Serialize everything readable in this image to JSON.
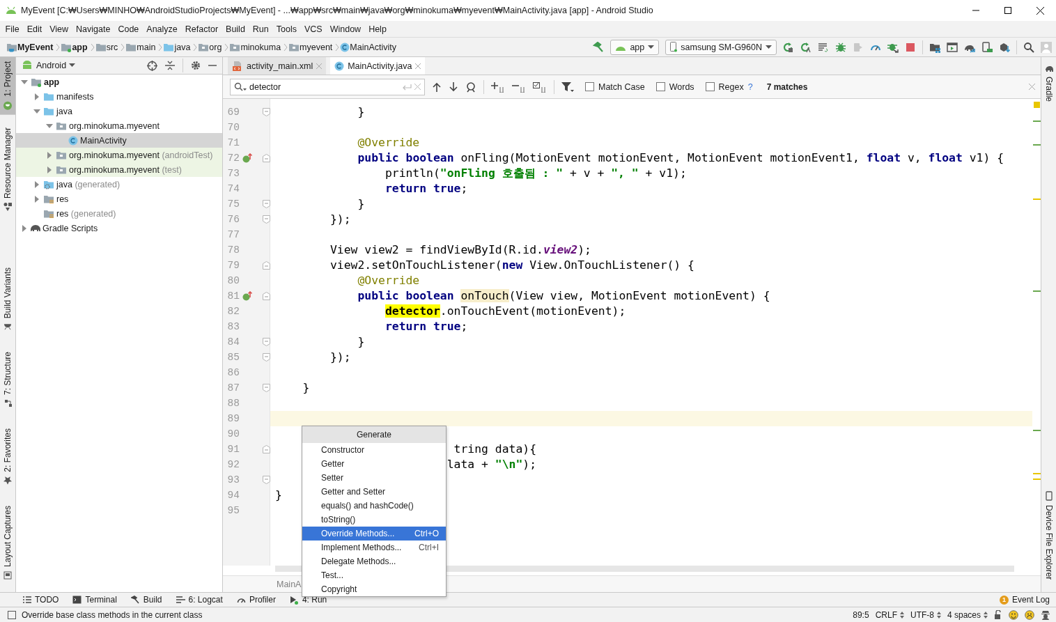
{
  "window": {
    "title": "MyEvent [C:₩Users₩MINHO₩AndroidStudioProjects₩MyEvent] - ...₩app₩src₩main₩java₩org₩minokuma₩myevent₩MainActivity.java [app] - Android Studio"
  },
  "menu": [
    "File",
    "Edit",
    "View",
    "Navigate",
    "Code",
    "Analyze",
    "Refactor",
    "Build",
    "Run",
    "Tools",
    "VCS",
    "Window",
    "Help"
  ],
  "breadcrumbs": [
    {
      "label": "MyEvent",
      "kind": "project"
    },
    {
      "label": "app",
      "kind": "module"
    },
    {
      "label": "src",
      "kind": "folder"
    },
    {
      "label": "main",
      "kind": "folder"
    },
    {
      "label": "java",
      "kind": "source-folder"
    },
    {
      "label": "org",
      "kind": "package"
    },
    {
      "label": "minokuma",
      "kind": "package"
    },
    {
      "label": "myevent",
      "kind": "package"
    },
    {
      "label": "MainActivity",
      "kind": "class"
    }
  ],
  "toolbar": {
    "configuration": "app",
    "device": "samsung SM-G960N"
  },
  "left_tools_top": [
    {
      "label": "1: Project",
      "kind": "project",
      "selected": true
    },
    {
      "label": "Resource Manager",
      "kind": "resources",
      "selected": false
    }
  ],
  "left_tools_bottom": [
    {
      "label": "Build Variants",
      "kind": "variants",
      "selected": false
    },
    {
      "label": "7: Structure",
      "kind": "structure",
      "selected": false
    },
    {
      "label": "2: Favorites",
      "kind": "favorites",
      "selected": false
    },
    {
      "label": "Layout Captures",
      "kind": "captures",
      "selected": false
    }
  ],
  "right_tools_top": [
    {
      "label": "Gradle",
      "kind": "gradle",
      "selected": false
    }
  ],
  "right_tools_bottom": [
    {
      "label": "Device File Explorer",
      "kind": "device",
      "selected": false
    }
  ],
  "project_panel": {
    "view": "Android",
    "tree": [
      {
        "label": "app",
        "kind": "module",
        "expanded": true,
        "selected": false,
        "test": false,
        "children": [
          {
            "label": "manifests",
            "kind": "source-folder",
            "expanded": false,
            "selected": false,
            "test": false
          },
          {
            "label": "java",
            "kind": "source-folder",
            "expanded": true,
            "selected": false,
            "test": false,
            "children": [
              {
                "label": "org.minokuma.myevent",
                "kind": "package",
                "expanded": true,
                "selected": false,
                "test": false,
                "children": [
                  {
                    "label": "MainActivity",
                    "kind": "class",
                    "selected": true,
                    "test": false
                  }
                ]
              },
              {
                "label": "org.minokuma.myevent",
                "suffix": "(androidTest)",
                "kind": "package",
                "expanded": false,
                "selected": false,
                "test": true
              },
              {
                "label": "org.minokuma.myevent",
                "suffix": "(test)",
                "kind": "package",
                "expanded": false,
                "selected": false,
                "test": true
              }
            ]
          },
          {
            "label": "java",
            "suffix": "(generated)",
            "kind": "generated-folder",
            "expanded": false,
            "selected": false,
            "test": false
          },
          {
            "label": "res",
            "kind": "res-folder",
            "expanded": false,
            "selected": false,
            "test": false
          },
          {
            "label": "res",
            "suffix": "(generated)",
            "kind": "res-folder",
            "selected": false,
            "test": false
          }
        ]
      },
      {
        "label": "Gradle Scripts",
        "kind": "gradle",
        "expanded": false,
        "selected": false,
        "test": false
      }
    ]
  },
  "editor_tabs": [
    {
      "label": "activity_main.xml",
      "kind": "xml",
      "selected": false
    },
    {
      "label": "MainActivity.java",
      "kind": "class",
      "selected": true
    }
  ],
  "find_bar": {
    "query": "detector",
    "options": [
      {
        "label": "Match Case",
        "checked": false
      },
      {
        "label": "Words",
        "checked": false
      },
      {
        "label": "Regex",
        "checked": false
      }
    ],
    "help": "?",
    "matches": "7 matches"
  },
  "code_lines": [
    {
      "n": "69",
      "fold_end": true,
      "override": false,
      "current": false,
      "tokens": [
        {
          "kind": "plain",
          "text": "            }"
        }
      ]
    },
    {
      "n": "70",
      "override": false,
      "current": false
    },
    {
      "n": "71",
      "override": false,
      "current": false,
      "tokens": [
        {
          "kind": "annotation",
          "text": "            @Override"
        }
      ]
    },
    {
      "n": "72",
      "fold_start": true,
      "override": true,
      "current": false,
      "tokens": [
        {
          "kind": "keyword",
          "text": "            public"
        },
        {
          "kind": "keyword",
          "text": " boolean"
        },
        {
          "kind": "plain",
          "text": " onFling(MotionEvent motionEvent, MotionEvent motionEvent1, "
        },
        {
          "kind": "keyword",
          "text": "float"
        },
        {
          "kind": "plain",
          "text": " v, "
        },
        {
          "kind": "keyword",
          "text": "float"
        },
        {
          "kind": "plain",
          "text": " v1) {"
        }
      ]
    },
    {
      "n": "73",
      "override": false,
      "current": false,
      "tokens": [
        {
          "kind": "plain",
          "text": "                println("
        },
        {
          "kind": "string",
          "text": "\"onFling 호출됨 : \""
        },
        {
          "kind": "plain",
          "text": " + v + "
        },
        {
          "kind": "string",
          "text": "\", \""
        },
        {
          "kind": "plain",
          "text": " + v1);"
        }
      ]
    },
    {
      "n": "74",
      "override": false,
      "current": false,
      "tokens": [
        {
          "kind": "keyword",
          "text": "                return"
        },
        {
          "kind": "keyword",
          "text": " true"
        },
        {
          "kind": "plain",
          "text": ";"
        }
      ]
    },
    {
      "n": "75",
      "fold_end": true,
      "override": false,
      "current": false,
      "tokens": [
        {
          "kind": "plain",
          "text": "            }"
        }
      ]
    },
    {
      "n": "76",
      "fold_end": true,
      "override": false,
      "current": false,
      "tokens": [
        {
          "kind": "plain",
          "text": "        });"
        }
      ]
    },
    {
      "n": "77",
      "override": false,
      "current": false
    },
    {
      "n": "78",
      "override": false,
      "current": false,
      "tokens": [
        {
          "kind": "plain",
          "text": "        View view2 = findViewById(R.id."
        },
        {
          "kind": "field",
          "text": "view2"
        },
        {
          "kind": "plain",
          "text": ");"
        }
      ]
    },
    {
      "n": "79",
      "fold_start": true,
      "override": false,
      "current": false,
      "tokens": [
        {
          "kind": "plain",
          "text": "        view2.setOnTouchListener("
        },
        {
          "kind": "keyword",
          "text": "new"
        },
        {
          "kind": "plain",
          "text": " View.OnTouchListener() {"
        }
      ]
    },
    {
      "n": "80",
      "override": false,
      "current": false,
      "tokens": [
        {
          "kind": "annotation",
          "text": "            @Override"
        }
      ]
    },
    {
      "n": "81",
      "fold_start": true,
      "override": true,
      "current": false,
      "tokens": [
        {
          "kind": "keyword",
          "text": "            public"
        },
        {
          "kind": "keyword",
          "text": " boolean"
        },
        {
          "kind": "usage",
          "text": " onTouch"
        },
        {
          "kind": "plain",
          "text": "(View view, MotionEvent motionEvent) {"
        }
      ]
    },
    {
      "n": "82",
      "override": false,
      "current": false,
      "tokens": [
        {
          "kind": "match",
          "text": "                detector"
        },
        {
          "kind": "plain",
          "text": ".onTouchEvent(motionEvent);"
        }
      ]
    },
    {
      "n": "83",
      "override": false,
      "current": false,
      "tokens": [
        {
          "kind": "keyword",
          "text": "                return"
        },
        {
          "kind": "keyword",
          "text": " true"
        },
        {
          "kind": "plain",
          "text": ";"
        }
      ]
    },
    {
      "n": "84",
      "fold_end": true,
      "override": false,
      "current": false,
      "tokens": [
        {
          "kind": "plain",
          "text": "            }"
        }
      ]
    },
    {
      "n": "85",
      "fold_end": true,
      "override": false,
      "current": false,
      "tokens": [
        {
          "kind": "plain",
          "text": "        });"
        }
      ]
    },
    {
      "n": "86",
      "override": false,
      "current": false
    },
    {
      "n": "87",
      "fold_end": true,
      "override": false,
      "current": false,
      "tokens": [
        {
          "kind": "plain",
          "text": "    }"
        }
      ]
    },
    {
      "n": "88",
      "override": false,
      "current": false
    },
    {
      "n": "89",
      "override": false,
      "current": true
    },
    {
      "n": "90",
      "override": false,
      "current": false
    },
    {
      "n": "91",
      "fold_start": true,
      "override": false,
      "current": false,
      "tokens": [
        {
          "kind": "plain",
          "text": "                          tring data){"
        }
      ]
    },
    {
      "n": "92",
      "override": false,
      "current": false,
      "tokens": [
        {
          "kind": "plain",
          "text": "                         lata + "
        },
        {
          "kind": "string",
          "text": "\"\\n\""
        },
        {
          "kind": "plain",
          "text": ");"
        }
      ]
    },
    {
      "n": "93",
      "fold_end": true,
      "override": false,
      "current": false
    },
    {
      "n": "94",
      "override": false,
      "current": false,
      "tokens": [
        {
          "kind": "plain",
          "text": "}"
        }
      ]
    },
    {
      "n": "95",
      "override": false,
      "current": false
    }
  ],
  "editor_breadcrumb": "MainA",
  "generate_popup": {
    "title": "Generate",
    "items": [
      {
        "label": "Constructor",
        "selected": false
      },
      {
        "label": "Getter",
        "selected": false
      },
      {
        "label": "Setter",
        "selected": false
      },
      {
        "label": "Getter and Setter",
        "selected": false
      },
      {
        "label": "equals() and hashCode()",
        "selected": false
      },
      {
        "label": "toString()",
        "selected": false
      },
      {
        "label": "Override Methods...",
        "shortcut": "Ctrl+O",
        "selected": true
      },
      {
        "label": "Implement Methods...",
        "shortcut": "Ctrl+I",
        "selected": false
      },
      {
        "label": "Delegate Methods...",
        "selected": false
      },
      {
        "label": "Test...",
        "selected": false
      },
      {
        "label": "Copyright",
        "selected": false
      }
    ]
  },
  "bottom_tools": [
    {
      "label": "TODO",
      "kind": "todo"
    },
    {
      "label": "Terminal",
      "kind": "terminal"
    },
    {
      "label": "Build",
      "kind": "build"
    },
    {
      "label": "6: Logcat",
      "kind": "logcat"
    },
    {
      "label": "Profiler",
      "kind": "profiler"
    },
    {
      "label": "4: Run",
      "kind": "run"
    }
  ],
  "event_log": {
    "label": "Event Log",
    "badge": "1"
  },
  "status_bar": {
    "message": "Override base class methods in the current class",
    "position": "89:5",
    "line_separator": "CRLF",
    "encoding": "UTF-8",
    "indent": "4 spaces"
  }
}
